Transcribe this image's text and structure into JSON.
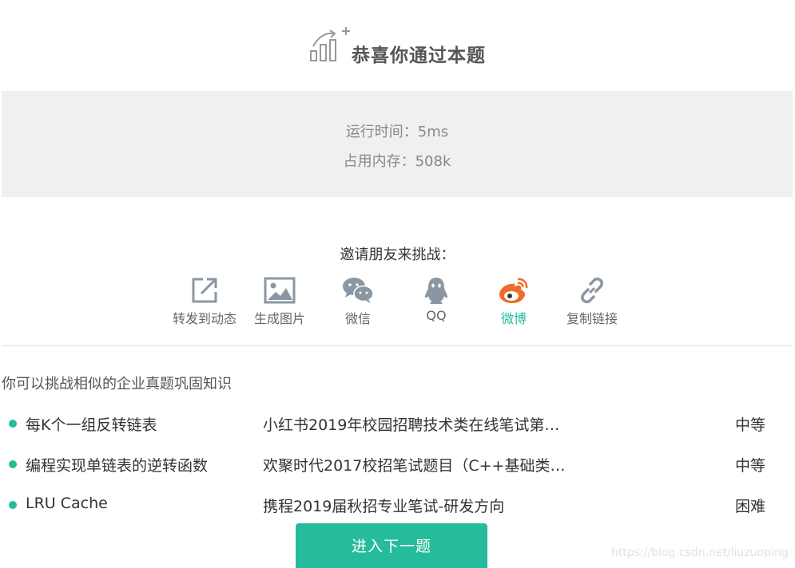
{
  "header": {
    "title": "恭喜你通过本题",
    "icon": "success-chart-icon"
  },
  "stats": {
    "runtime": "运行时间：5ms",
    "memory": "占用内存：508k"
  },
  "invite": {
    "title": "邀请朋友来挑战："
  },
  "share": [
    {
      "label": "转发到动态",
      "icon": "share-external-icon"
    },
    {
      "label": "生成图片",
      "icon": "image-icon"
    },
    {
      "label": "微信",
      "icon": "wechat-icon"
    },
    {
      "label": "QQ",
      "icon": "qq-icon"
    },
    {
      "label": "微博",
      "icon": "weibo-icon"
    },
    {
      "label": "复制链接",
      "icon": "link-icon"
    }
  ],
  "similar": {
    "title": "你可以挑战相似的企业真题巩固知识",
    "questions": [
      {
        "name": "每K个一组反转链表",
        "source": "小红书2019年校园招聘技术类在线笔试第…",
        "level": "中等"
      },
      {
        "name": "编程实现单链表的逆转函数",
        "source": "欢聚时代2017校招笔试题目（C++基础类…",
        "level": "中等"
      },
      {
        "name": "LRU Cache",
        "source": "携程2019届秋招专业笔试-研发方向",
        "level": "困难"
      }
    ]
  },
  "next_button": "进入下一题",
  "watermark": "https://blog.csdn.net/liuzuoping",
  "colors": {
    "accent": "#25bb9b",
    "stats_bg": "#f0f0f0",
    "weibo_orange": "#f06b2b",
    "icon_gray": "#8a97a3"
  }
}
